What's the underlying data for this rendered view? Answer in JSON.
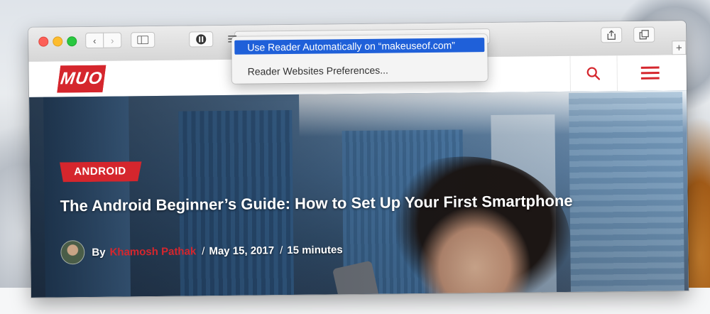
{
  "browser": {
    "back_label": "‹",
    "forward_label": "›",
    "newtab_label": "+"
  },
  "reader_menu": {
    "items": [
      {
        "label": "Use Reader Automatically on “makeuseof.com”",
        "selected": true
      },
      {
        "label": "Reader Websites Preferences...",
        "selected": false
      }
    ]
  },
  "site": {
    "logo_text": "MUO",
    "icons": {
      "search": "search-icon",
      "menu": "hamburger-menu-icon"
    },
    "accent_color": "#d5262d"
  },
  "article": {
    "category": "ANDROID",
    "title": "The Android Beginner’s Guide: How to Set Up Your First Smartphone",
    "by_label": "By",
    "author": "Khamosh Pathak",
    "date": "May 15, 2017",
    "read_time": "15 minutes",
    "separator": "/"
  }
}
